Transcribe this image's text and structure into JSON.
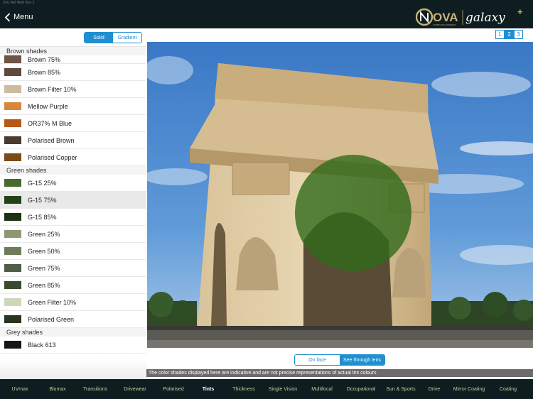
{
  "header": {
    "status_text": "9:41 AM  Wed Nov 2",
    "back_label": "Menu",
    "brand_left": "OVA",
    "brand_sub": "COMPLETE EYEWEAR",
    "brand_right": "galaxy",
    "brand_plus": "+"
  },
  "mode_toggle": {
    "solid": "Solid",
    "gradient": "Gradient"
  },
  "shade_groups": [
    {
      "title": "Brown shades",
      "items": [
        {
          "label": "Brown 75%",
          "color": "#6e5446"
        },
        {
          "label": "Brown 85%",
          "color": "#5e4a3c"
        },
        {
          "label": "Brown Filter 10%",
          "color": "#cdbb9e"
        },
        {
          "label": "Mellow Purple",
          "color": "#d6893a"
        },
        {
          "label": "OR37% M Blue",
          "color": "#b5581a"
        },
        {
          "label": "Polarised Brown",
          "color": "#4a3b2e"
        },
        {
          "label": "Polarised Copper",
          "color": "#7b4b16"
        }
      ]
    },
    {
      "title": "Green shades",
      "items": [
        {
          "label": "G-15 25%",
          "color": "#486b30"
        },
        {
          "label": "G-15 75%",
          "color": "#24421a"
        },
        {
          "label": "G-15 85%",
          "color": "#1b3313"
        },
        {
          "label": "Green 25%",
          "color": "#8c9970"
        },
        {
          "label": "Green 50%",
          "color": "#6e7c5c"
        },
        {
          "label": "Green 75%",
          "color": "#4e5d44"
        },
        {
          "label": "Green 85%",
          "color": "#3a4a2c"
        },
        {
          "label": "Green Filter 10%",
          "color": "#ced6bc"
        },
        {
          "label": "Polarised Green",
          "color": "#28351f"
        }
      ]
    },
    {
      "title": "Grey shades",
      "items": [
        {
          "label": "Black 613",
          "color": "#161616"
        }
      ]
    }
  ],
  "selected_shade": "G-15 75%",
  "lens_color": "#2f6a1a",
  "pager": [
    "1",
    "2",
    "3"
  ],
  "pager_current": "2",
  "view_toggle": {
    "on_face": "On face",
    "through_lens": "See through lens"
  },
  "disclaimer": "The color shades displayed here are indicative and are not precise representations of actual tint colours",
  "bottom_tabs": [
    "UVmax",
    "Blumax",
    "Transitions",
    "Drivewear",
    "Polarised",
    "Tints",
    "Thickness",
    "Single Vision",
    "Multifocal",
    "Occupational",
    "Sun & Sports",
    "Drive",
    "Mirror Coating",
    "Coating"
  ],
  "active_tab": "Tints",
  "accent_color": "#1e8fd0"
}
